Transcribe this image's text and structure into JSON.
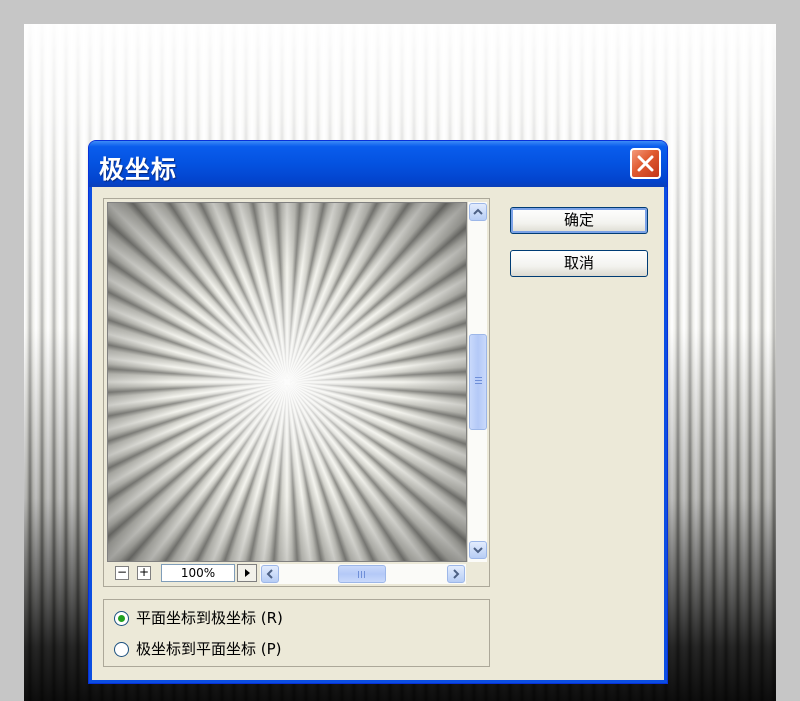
{
  "dialog": {
    "title": "极坐标",
    "close_icon": "close-icon",
    "buttons": {
      "ok_label": "确定",
      "cancel_label": "取消"
    },
    "preview": {
      "zoom_value": "100%",
      "zoom_out_label": "−",
      "zoom_in_label": "+"
    },
    "options": [
      {
        "label": "平面坐标到极坐标 (R)",
        "selected": true
      },
      {
        "label": "极坐标到平面坐标 (P)",
        "selected": false
      }
    ]
  },
  "colors": {
    "titlebar": "#0452e0",
    "dialog_bg": "#ece9d8",
    "close_button": "#e05a30",
    "radio_dot": "#21a121"
  }
}
